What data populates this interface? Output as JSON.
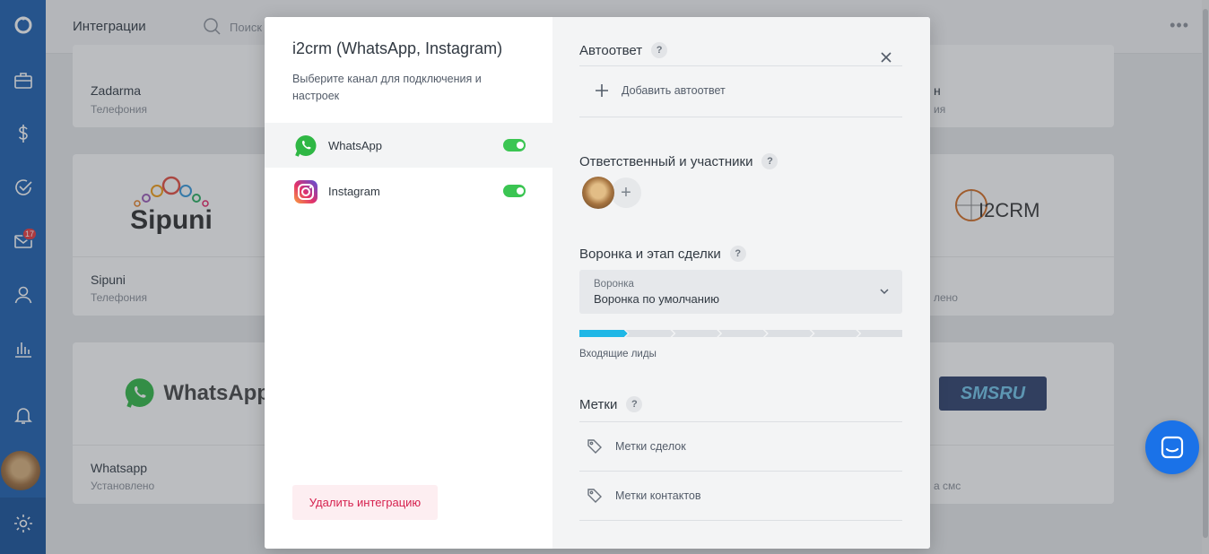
{
  "nav": {
    "mail_badge": "17"
  },
  "page": {
    "title": "Интеграции",
    "search_placeholder": "Поиск",
    "cards": [
      {
        "name": "Zadarma",
        "sub": "Телефония"
      },
      {
        "name": "Sipuni",
        "sub": "Телефония",
        "logo_text": "Sipuni"
      },
      {
        "name": "Whatsapp",
        "sub": "Установлено",
        "logo_text": "WhatsApp"
      },
      {
        "name": "н",
        "sub": "ия"
      },
      {
        "name": "",
        "sub": "лено",
        "logo_text": "I2CRM"
      },
      {
        "name": "",
        "sub": "а смс",
        "logo_text": "SMSRU"
      }
    ]
  },
  "modal": {
    "title": "i2crm (WhatsApp, Instagram)",
    "description": "Выберите канал для подключения и настроек",
    "channels": [
      {
        "label": "WhatsApp",
        "enabled": true,
        "icon": "whatsapp-icon"
      },
      {
        "label": "Instagram",
        "enabled": true,
        "icon": "instagram-icon"
      }
    ],
    "delete_label": "Удалить интеграцию",
    "autoreply": {
      "title": "Автоответ",
      "add_label": "Добавить автоответ"
    },
    "responsible": {
      "title": "Ответственный и участники"
    },
    "pipeline": {
      "title": "Воронка и этап сделки",
      "select_label": "Воронка",
      "select_value": "Воронка по умолчанию",
      "stage_caption": "Входящие лиды",
      "stage_count": 7,
      "active_stage": 0
    },
    "tags": {
      "title": "Метки",
      "items": [
        "Метки сделок",
        "Метки контактов"
      ]
    },
    "help_mark": "?"
  },
  "colors": {
    "nav_bg": "#1b5fb0",
    "toggle_on": "#3bc552",
    "stage_active": "#1fb7e6",
    "stage_inactive": "#dcdfe3",
    "delete_text": "#d6224f",
    "chat_btn": "#1a72e8"
  }
}
